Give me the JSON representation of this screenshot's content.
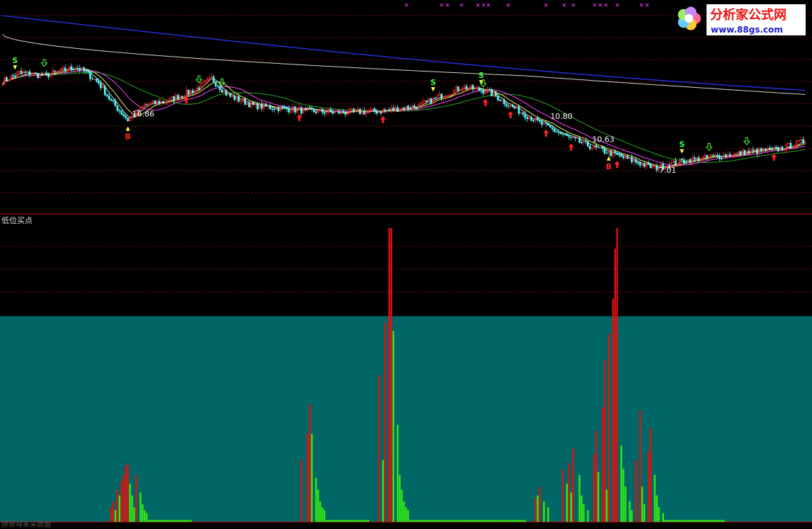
{
  "indicator_title": "低位买点",
  "bottom_text": "拼命得来采数据",
  "logo": {
    "name": "分析家公式网",
    "url": "www.88gs.com"
  },
  "colors": {
    "background": "#000000",
    "teal_panel": "#006666",
    "grid": "#7a1010",
    "divider": "#c81414",
    "up": "#ff2020",
    "down": "#54ffff",
    "bar_red": "#e01010",
    "bar_green": "#33ee11",
    "ma_blue": "#2030d8",
    "ma_white": "#d8d8c8",
    "ma_green": "#22aa22",
    "ma_magenta": "#ff44ff",
    "ma_yellow": "#eeee66",
    "signal_magenta": "#ff44ff",
    "signal_yellow": "#ffff44",
    "signal_green": "#44ff44",
    "signal_red": "#ff2222",
    "label_white": "#ffffff",
    "logo_red": "#ee1111",
    "logo_blue": "#1a1acc"
  },
  "price_labels": [
    "16.86",
    "10.80",
    "10.63",
    "7.01"
  ],
  "signals": {
    "sell_letter": "S",
    "buy_letter": "B"
  },
  "chart_data": [
    {
      "type": "candlestick",
      "title": "",
      "price_ylim": [
        6.5,
        20.5
      ],
      "n_bars": 385,
      "annotations": [
        {
          "text": "16.86",
          "kind": "high",
          "bar": 60
        },
        {
          "text": "10.80",
          "kind": "level",
          "bar": 260
        },
        {
          "text": "10.63",
          "kind": "level",
          "bar": 280
        },
        {
          "text": "7.01",
          "kind": "low",
          "bar": 312
        }
      ],
      "signals": [
        {
          "type": "S",
          "bar": 6
        },
        {
          "type": "B",
          "bar": 60
        },
        {
          "type": "S",
          "bar": 206
        },
        {
          "type": "S",
          "bar": 229
        },
        {
          "type": "B",
          "bar": 290
        },
        {
          "type": "S",
          "bar": 325
        }
      ],
      "grid": true
    },
    {
      "type": "bar",
      "title": "低位买点",
      "ylim": [
        0,
        100
      ],
      "baseline_panel_level": 70,
      "series": [
        {
          "color": "red",
          "values": [
            {
              "bar": 52,
              "v": 5
            },
            {
              "bar": 53,
              "v": 7
            },
            {
              "bar": 55,
              "v": 11
            },
            {
              "bar": 57,
              "v": 14
            },
            {
              "bar": 58,
              "v": 16
            },
            {
              "bar": 59,
              "v": 19
            },
            {
              "bar": 60,
              "v": 20
            },
            {
              "bar": 64,
              "v": 16
            },
            {
              "bar": 143,
              "v": 21
            },
            {
              "bar": 146,
              "v": 30
            },
            {
              "bar": 147,
              "v": 40
            },
            {
              "bar": 180,
              "v": 50
            },
            {
              "bar": 183,
              "v": 68
            },
            {
              "bar": 185,
              "v": 100
            },
            {
              "bar": 186,
              "v": 100
            },
            {
              "bar": 255,
              "v": 8
            },
            {
              "bar": 257,
              "v": 12
            },
            {
              "bar": 268,
              "v": 18
            },
            {
              "bar": 271,
              "v": 20
            },
            {
              "bar": 273,
              "v": 25
            },
            {
              "bar": 283,
              "v": 23
            },
            {
              "bar": 284,
              "v": 31
            },
            {
              "bar": 287,
              "v": 39
            },
            {
              "bar": 288,
              "v": 55
            },
            {
              "bar": 290,
              "v": 64
            },
            {
              "bar": 292,
              "v": 76
            },
            {
              "bar": 293,
              "v": 93
            },
            {
              "bar": 294,
              "v": 100
            },
            {
              "bar": 303,
              "v": 21
            },
            {
              "bar": 305,
              "v": 38
            },
            {
              "bar": 309,
              "v": 24
            },
            {
              "bar": 310,
              "v": 32
            }
          ]
        },
        {
          "color": "green",
          "values": [
            {
              "bar": 54,
              "v": 4
            },
            {
              "bar": 56,
              "v": 9
            },
            {
              "bar": 61,
              "v": 13
            },
            {
              "bar": 62,
              "v": 9
            },
            {
              "bar": 63,
              "v": 5
            },
            {
              "bar": 66,
              "v": 10
            },
            {
              "bar": 67,
              "v": 6
            },
            {
              "bar": 68,
              "v": 4
            },
            {
              "bar": 69,
              "v": 3
            },
            {
              "bar": 148,
              "v": 30
            },
            {
              "bar": 150,
              "v": 15
            },
            {
              "bar": 151,
              "v": 11
            },
            {
              "bar": 152,
              "v": 7
            },
            {
              "bar": 153,
              "v": 5
            },
            {
              "bar": 154,
              "v": 4
            },
            {
              "bar": 182,
              "v": 21
            },
            {
              "bar": 187,
              "v": 65
            },
            {
              "bar": 189,
              "v": 33
            },
            {
              "bar": 190,
              "v": 16
            },
            {
              "bar": 191,
              "v": 11
            },
            {
              "bar": 192,
              "v": 7
            },
            {
              "bar": 193,
              "v": 5
            },
            {
              "bar": 194,
              "v": 4
            },
            {
              "bar": 256,
              "v": 9
            },
            {
              "bar": 259,
              "v": 7
            },
            {
              "bar": 261,
              "v": 5
            },
            {
              "bar": 270,
              "v": 13
            },
            {
              "bar": 272,
              "v": 10
            },
            {
              "bar": 276,
              "v": 16
            },
            {
              "bar": 277,
              "v": 9
            },
            {
              "bar": 278,
              "v": 6
            },
            {
              "bar": 280,
              "v": 4
            },
            {
              "bar": 285,
              "v": 17
            },
            {
              "bar": 289,
              "v": 11
            },
            {
              "bar": 296,
              "v": 26
            },
            {
              "bar": 297,
              "v": 18
            },
            {
              "bar": 298,
              "v": 12
            },
            {
              "bar": 300,
              "v": 7
            },
            {
              "bar": 301,
              "v": 4
            },
            {
              "bar": 306,
              "v": 12
            },
            {
              "bar": 307,
              "v": 6
            },
            {
              "bar": 312,
              "v": 16
            },
            {
              "bar": 313,
              "v": 9
            },
            {
              "bar": 314,
              "v": 5
            },
            {
              "bar": 316,
              "v": 3
            }
          ]
        }
      ]
    }
  ]
}
